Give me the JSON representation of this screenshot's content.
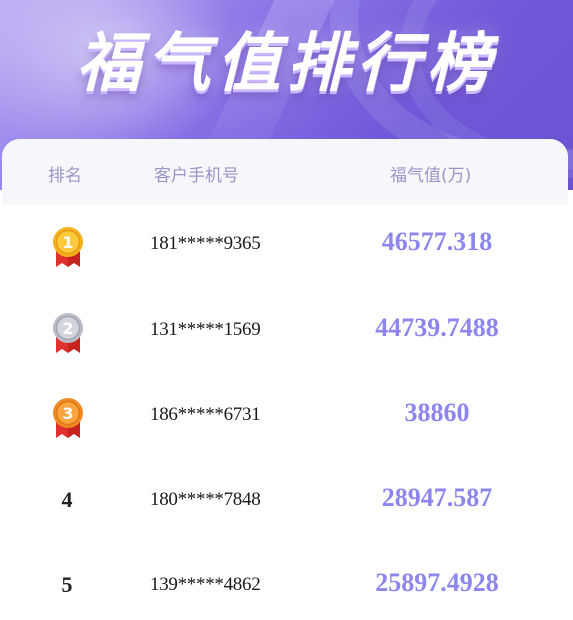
{
  "header": {
    "title": "福气值排行榜"
  },
  "table": {
    "columns": {
      "rank": "排名",
      "phone": "客户手机号",
      "value": "福气值(万)"
    },
    "rows": [
      {
        "rank": "1",
        "phone": "181*****9365",
        "value": "46577.318",
        "medal": "gold-medal-icon",
        "medal_color": "#f5b21f"
      },
      {
        "rank": "2",
        "phone": "131*****1569",
        "value": "44739.7488",
        "medal": "silver-medal-icon",
        "medal_color": "#b9bcc6"
      },
      {
        "rank": "3",
        "phone": "186*****6731",
        "value": "38860",
        "medal": "bronze-medal-icon",
        "medal_color": "#f08a25"
      },
      {
        "rank": "4",
        "phone": "180*****7848",
        "value": "28947.587"
      },
      {
        "rank": "5",
        "phone": "139*****4862",
        "value": "25897.4928"
      }
    ]
  },
  "colors": {
    "accent": "#8c86ef",
    "header_text": "#9a95c8",
    "ribbon": "#e0312f"
  }
}
